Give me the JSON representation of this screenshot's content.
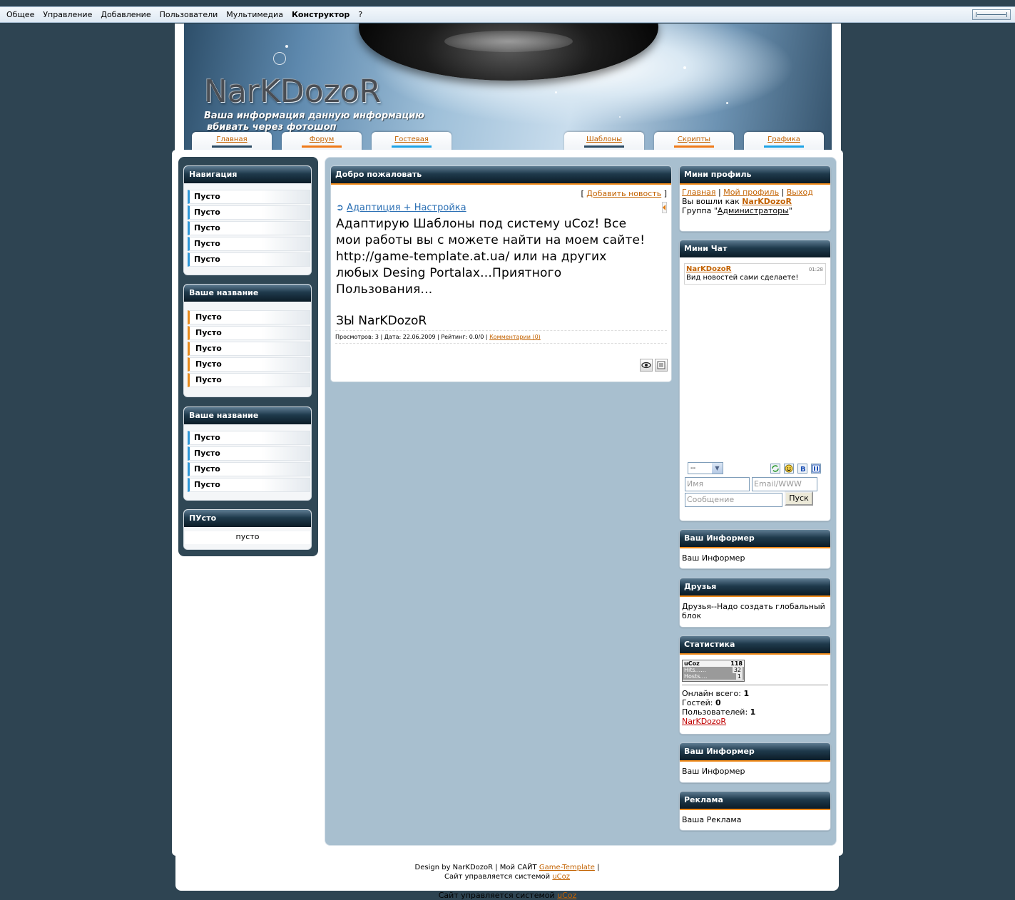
{
  "topbar": {
    "menu": [
      "Общее",
      "Управление",
      "Добавление",
      "Пользователи",
      "Мультимедиа",
      "Конструктор",
      "?"
    ]
  },
  "header": {
    "logo": "NarKDozoR",
    "slogan_line1": "Ваша информация данную информацию",
    "slogan_line2": "вбивать через фотошоп",
    "tabs": [
      {
        "label": "Главная",
        "color": "#2c4b63"
      },
      {
        "label": "Форум",
        "color": "#ef7a1a"
      },
      {
        "label": "Гостевая",
        "color": "#1ea3e6"
      },
      {
        "label": "Шаблоны",
        "color": "#2c4b63"
      },
      {
        "label": "Скрипты",
        "color": "#ef7a1a"
      },
      {
        "label": "Графика",
        "color": "#1ea3e6"
      }
    ]
  },
  "left": {
    "nav": {
      "title": "Навигация",
      "items": [
        "Пусто",
        "Пусто",
        "Пусто",
        "Пусто",
        "Пусто"
      ]
    },
    "block2": {
      "title": "Ваше название",
      "items": [
        "Пусто",
        "Пусто",
        "Пусто",
        "Пусто",
        "Пусто"
      ]
    },
    "block3": {
      "title": "Ваше название",
      "items": [
        "Пусто",
        "Пусто",
        "Пусто",
        "Пусто"
      ]
    },
    "block4": {
      "title": "ПУсто",
      "text": "пусто"
    }
  },
  "news": {
    "block_title": "Добро пожаловать",
    "add_link": "Добавить новость",
    "entry_title": "Адаптиция + Настройка",
    "body": "Адаптирую Шаблоны под систему uCoz! Все мои работы вы с можете найти на моем сайте! http://game-template.at.ua/ или на других любых Desing Portalax...Приятного Пользования...",
    "signature": "ЗЫ NarKDozoR",
    "meta": "Просмотров: 3 | Дата: 22.06.2009 | Рейтинг: 0.0/0 |",
    "comments_link": "Комментарии (0)"
  },
  "right": {
    "profile": {
      "title": "Мини профиль",
      "links": [
        "Главная",
        "Мой профиль",
        "Выход"
      ],
      "logged_prefix": "Вы вошли как",
      "username": "NarKDozoR",
      "group_prefix": "Группа \"",
      "group": "Администраторы",
      "group_suffix": "\""
    },
    "chat": {
      "title": "Мини Чат",
      "msg_user": "NarKDozoR",
      "msg_time": "01:28",
      "msg_text": "Вид новостей сами сделаете!",
      "select_value": "--",
      "name_placeholder": "Имя",
      "email_placeholder": "Email/WWW",
      "message_placeholder": "Сообщение",
      "send_button": "Пуск"
    },
    "informer1": {
      "title": "Ваш Информер",
      "text": "Ваш Информер"
    },
    "friends": {
      "title": "Друзья",
      "text": "Друзья--Надо создать глобальный блок"
    },
    "stats": {
      "title": "Статистика",
      "counter": {
        "brand": "uCoz",
        "total": "118",
        "hits_label": "Hits......",
        "hits": "32",
        "hosts_label": "Hosts....",
        "hosts": "1"
      },
      "online_label": "Онлайн всего:",
      "online": "1",
      "guests_label": "Гостей:",
      "guests": "0",
      "users_label": "Пользователей:",
      "users": "1",
      "user_link": "NarKDozoR"
    },
    "informer2": {
      "title": "Ваш Информер",
      "text": "Ваш Информер"
    },
    "ads": {
      "title": "Реклама",
      "text": "Ваша Реклама"
    }
  },
  "footer": {
    "line1_prefix": "Design by NarKDozoR | Мой САЙТ",
    "line1_link": "Game-Template",
    "line1_suffix": "|",
    "line2_prefix": "Сайт управляется системой",
    "line2_link": "uCoz"
  },
  "bottom": {
    "prefix": "Сайт управляется системой",
    "link": "uCoz"
  }
}
